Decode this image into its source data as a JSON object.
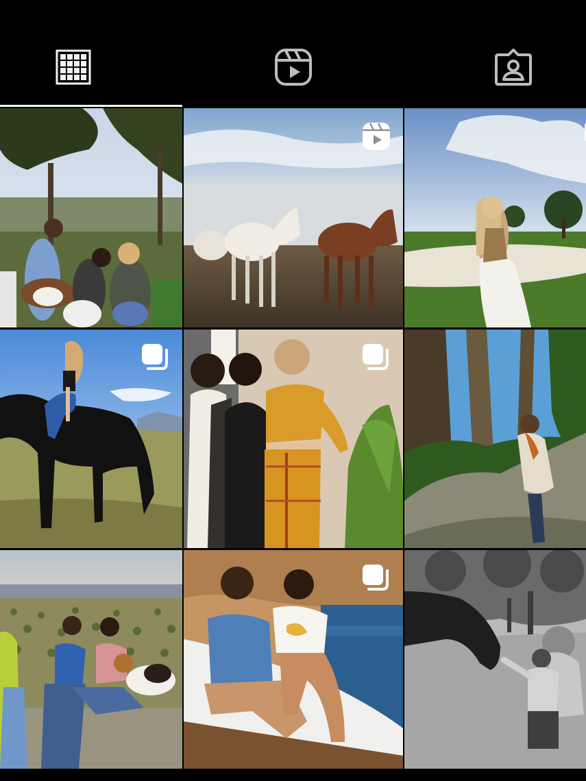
{
  "tabs": [
    {
      "icon": "grid-icon",
      "active": true
    },
    {
      "icon": "reels-icon",
      "active": false
    },
    {
      "icon": "tagged-icon",
      "active": false
    }
  ],
  "colors": {
    "background": "#000000",
    "icon": "#f2f2f2",
    "active_indicator": "#f5f5f5"
  },
  "posts": [
    {
      "subject": "friends-with-dogs",
      "badge": null
    },
    {
      "subject": "horses-field",
      "badge": "reel-icon"
    },
    {
      "subject": "golf-course-portrait",
      "badge": "carousel-icon"
    },
    {
      "subject": "rider-black-horse",
      "badge": "carousel-icon"
    },
    {
      "subject": "three-friends-indoor",
      "badge": "carousel-icon"
    },
    {
      "subject": "woman-on-rock",
      "badge": null
    },
    {
      "subject": "friends-with-beagle",
      "badge": null
    },
    {
      "subject": "friends-on-boat",
      "badge": "carousel-icon"
    },
    {
      "subject": "horse-and-child-bw",
      "badge": null
    }
  ]
}
